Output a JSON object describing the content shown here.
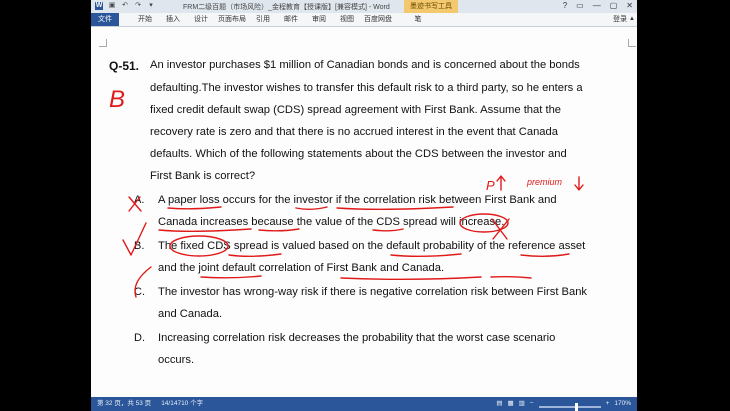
{
  "titlebar": {
    "title": "FRM二级百题（市场风险）_金程教育【授课版】[兼容模式] - Word",
    "contextual_tab": "墨迹书写工具"
  },
  "ribbon": {
    "file_tab": "文件",
    "tabs": [
      "开始",
      "插入",
      "设计",
      "页面布局",
      "引用",
      "邮件",
      "审阅",
      "视图",
      "百度网盘",
      "笔"
    ],
    "login": "登录"
  },
  "document": {
    "question_label": "Q-51.",
    "stem_lines": [
      "An investor purchases $1 million of Canadian bonds and is concerned about the bonds",
      "defaulting.The investor wishes to transfer this default risk to a third party, so he enters a",
      "fixed credit default swap (CDS) spread agreement with First Bank. Assume that the",
      "recovery rate is zero and that there is no accrued interest in the event that Canada",
      "defaults. Which of the following statements about the CDS between the investor and",
      "First Bank is correct?"
    ],
    "options": [
      {
        "letter": "A.",
        "lines": [
          "A paper loss occurs for the investor if the correlation risk between First Bank and",
          "Canada increases because the value of the CDS spread will increase."
        ]
      },
      {
        "letter": "B.",
        "lines": [
          "The fixed CDS spread is valued based on the default probability of the reference asset",
          "and the joint default correlation of First Bank and Canada."
        ]
      },
      {
        "letter": "C.",
        "lines": [
          "The investor has wrong-way risk if there is negative correlation risk between First Bank",
          "and Canada."
        ]
      },
      {
        "letter": "D.",
        "lines": [
          "Increasing correlation risk decreases the probability that the worst case scenario",
          "occurs."
        ]
      }
    ],
    "handwriting": {
      "answer": "B",
      "note_p": "P",
      "note_premium": "premium",
      "color": "#e01a1a"
    }
  },
  "statusbar": {
    "page": "第 32 页，共 53 页",
    "words": "14/14710 个字",
    "zoom": "170%"
  }
}
